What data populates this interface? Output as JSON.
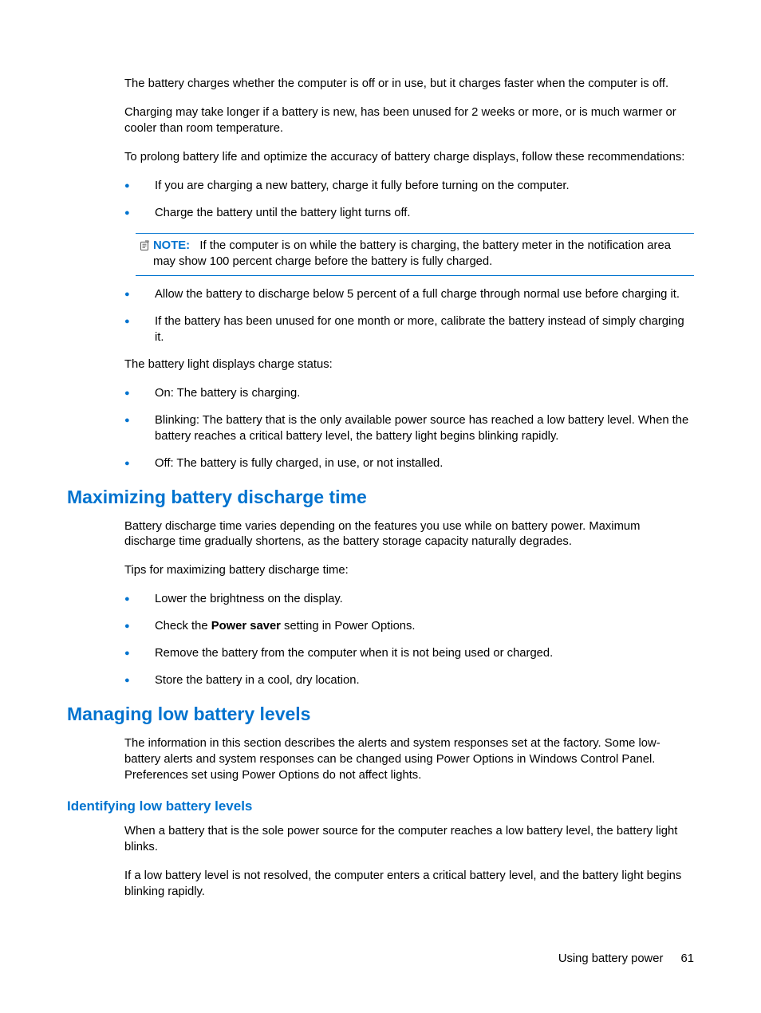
{
  "section1": {
    "p1": "The battery charges whether the computer is off or in use, but it charges faster when the computer is off.",
    "p2": "Charging may take longer if a battery is new, has been unused for 2 weeks or more, or is much warmer or cooler than room temperature.",
    "p3": "To prolong battery life and optimize the accuracy of battery charge displays, follow these recommendations:",
    "list1": {
      "i1": "If you are charging a new battery, charge it fully before turning on the computer.",
      "i2": "Charge the battery until the battery light turns off."
    },
    "note": {
      "label": "NOTE:",
      "text": "If the computer is on while the battery is charging, the battery meter in the notification area may show 100 percent charge before the battery is fully charged."
    },
    "list2": {
      "i1": "Allow the battery to discharge below 5 percent of a full charge through normal use before charging it.",
      "i2": "If the battery has been unused for one month or more, calibrate the battery instead of simply charging it."
    },
    "p4": "The battery light displays charge status:",
    "list3": {
      "i1": "On: The battery is charging.",
      "i2": "Blinking: The battery that is the only available power source has reached a low battery level. When the battery reaches a critical battery level, the battery light begins blinking rapidly.",
      "i3": "Off: The battery is fully charged, in use, or not installed."
    }
  },
  "section2": {
    "heading": "Maximizing battery discharge time",
    "p1": "Battery discharge time varies depending on the features you use while on battery power. Maximum discharge time gradually shortens, as the battery storage capacity naturally degrades.",
    "p2": "Tips for maximizing battery discharge time:",
    "list": {
      "i1": "Lower the brightness on the display.",
      "i2a": "Check the ",
      "i2b": "Power saver",
      "i2c": " setting in Power Options.",
      "i3": "Remove the battery from the computer when it is not being used or charged.",
      "i4": "Store the battery in a cool, dry location."
    }
  },
  "section3": {
    "heading": "Managing low battery levels",
    "p1": "The information in this section describes the alerts and system responses set at the factory. Some low-battery alerts and system responses can be changed using Power Options in Windows Control Panel. Preferences set using Power Options do not affect lights.",
    "sub": {
      "heading": "Identifying low battery levels",
      "p1": "When a battery that is the sole power source for the computer reaches a low battery level, the battery light blinks.",
      "p2": "If a low battery level is not resolved, the computer enters a critical battery level, and the battery light begins blinking rapidly."
    }
  },
  "footer": {
    "section": "Using battery power",
    "page": "61"
  }
}
